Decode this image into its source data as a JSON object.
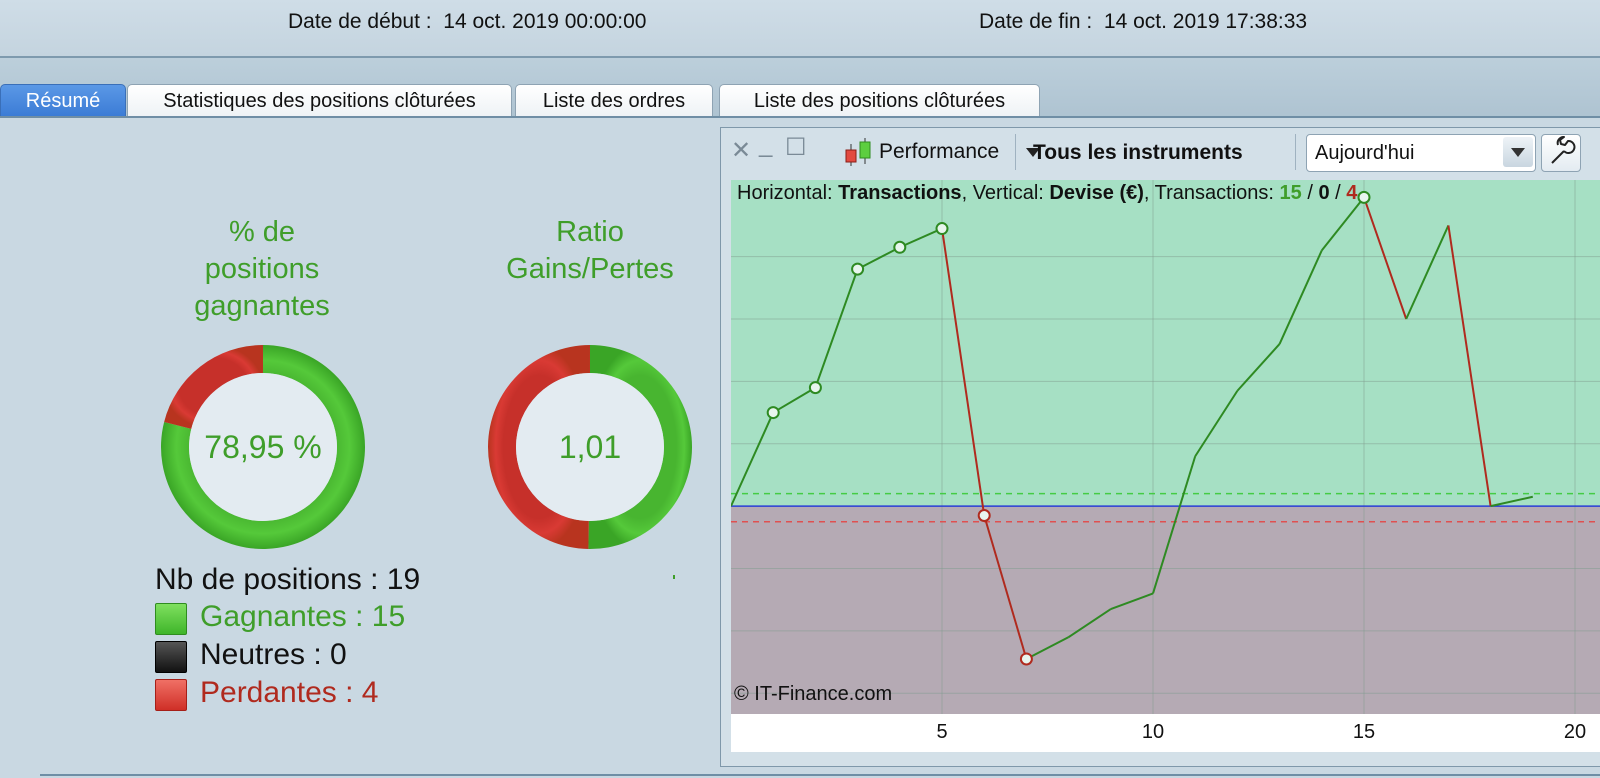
{
  "header": {
    "start_label": "Date de début :",
    "start_value": "14 oct. 2019 00:00:00",
    "end_label": "Date de fin :",
    "end_value": "14 oct. 2019 17:38:33"
  },
  "tabs": [
    {
      "label": "Résumé",
      "active": true
    },
    {
      "label": "Statistiques des positions clôturées",
      "active": false
    },
    {
      "label": "Liste des ordres",
      "active": false
    },
    {
      "label": "Liste des positions clôturées",
      "active": false
    }
  ],
  "summary": {
    "win_pct": {
      "title_lines": [
        "% de",
        "positions",
        "gagnantes"
      ],
      "value": "78,95 %",
      "fraction": 0.7895
    },
    "ratio": {
      "title_lines": [
        "Ratio",
        "Gains/Pertes"
      ],
      "value": "1,01",
      "win_fraction": 0.5025
    },
    "legend": {
      "total": "Nb de positions : 19",
      "winning": "Gagnantes : 15",
      "neutral": "Neutres : 0",
      "losing": "Perdantes : 4"
    }
  },
  "colors": {
    "win": "#55c93a",
    "lose": "#d93a34",
    "neutral": "#222222",
    "title_green": "#3f9e2a",
    "loss_red": "#b02a1e",
    "tab_active": "#3a7bd5"
  },
  "chart_window": {
    "performance_label": "Performance",
    "instrument_label": "Tous les instruments",
    "period_value": "Aujourd'hui",
    "icons": [
      "close-icon",
      "minimize-icon",
      "maximize-icon",
      "candlestick-icon",
      "dropdown-arrow-icon",
      "wrench-icon"
    ],
    "info": {
      "horizontal_label": "Horizontal:",
      "horizontal_value": "Transactions",
      "vertical_label": "Vertical:",
      "vertical_value": "Devise (€)",
      "transactions_label": "Transactions:",
      "win_count": "15",
      "neutral_count": "0",
      "lose_count": "4",
      "slash": "/"
    },
    "copyright": "© IT-Finance.com"
  },
  "chart_data": {
    "type": "line",
    "xlabel": "Transactions",
    "ylabel": "Devise (€)",
    "xlim": [
      0,
      20
    ],
    "ylim": [
      -3.3,
      5.1
    ],
    "x_ticks": [
      5,
      10,
      15,
      20
    ],
    "y_gridlines": [
      -3,
      -2,
      -1,
      0,
      1,
      2,
      3,
      4
    ],
    "grid": true,
    "zero_line": 0,
    "upper_dashed": 0.2,
    "lower_dashed": -0.25,
    "points": [
      {
        "x": 0,
        "y": 0.0,
        "marker": false
      },
      {
        "x": 1,
        "y": 1.5,
        "marker": true
      },
      {
        "x": 2,
        "y": 1.9,
        "marker": true
      },
      {
        "x": 3,
        "y": 3.8,
        "marker": true
      },
      {
        "x": 4,
        "y": 4.15,
        "marker": true
      },
      {
        "x": 5,
        "y": 4.45,
        "marker": true
      },
      {
        "x": 6,
        "y": -0.15,
        "marker": true
      },
      {
        "x": 7,
        "y": -2.45,
        "marker": true
      },
      {
        "x": 8,
        "y": -2.1,
        "marker": false
      },
      {
        "x": 9,
        "y": -1.65,
        "marker": false
      },
      {
        "x": 10,
        "y": -1.4,
        "marker": false
      },
      {
        "x": 11,
        "y": 0.8,
        "marker": false
      },
      {
        "x": 12,
        "y": 1.85,
        "marker": false
      },
      {
        "x": 13,
        "y": 2.6,
        "marker": false
      },
      {
        "x": 14,
        "y": 4.1,
        "marker": false
      },
      {
        "x": 15,
        "y": 4.95,
        "marker": true
      },
      {
        "x": 16,
        "y": 3.0,
        "marker": false
      },
      {
        "x": 17,
        "y": 4.5,
        "marker": false
      },
      {
        "x": 18,
        "y": 0.0,
        "marker": false
      },
      {
        "x": 19,
        "y": 0.15,
        "marker": false
      }
    ]
  }
}
